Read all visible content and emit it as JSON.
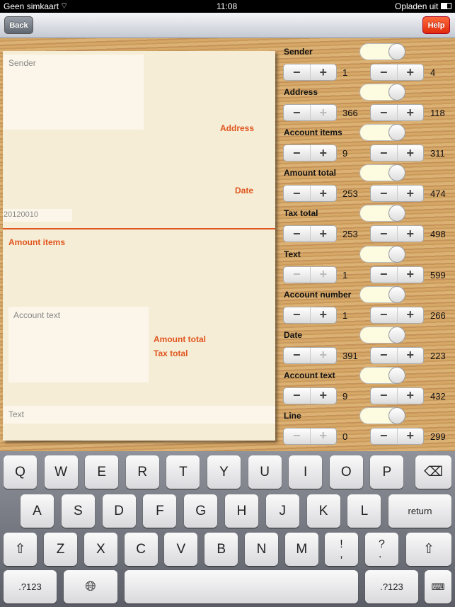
{
  "status": {
    "carrier": "Geen simkaart",
    "time": "11:08",
    "battery": "Opladen uit"
  },
  "nav": {
    "back": "Back",
    "help": "Help"
  },
  "document": {
    "sender_placeholder": "Sender",
    "address": "Address",
    "date": "Date",
    "date_value": "20120010",
    "amount_items": "Amount items",
    "account_text_placeholder": "Account text",
    "amount_total": "Amount total",
    "tax_total": "Tax total",
    "text_placeholder": "Text"
  },
  "controls": [
    {
      "label": "Sender",
      "on": true,
      "v1": "1",
      "v2": "4",
      "dis1": [
        false,
        false
      ]
    },
    {
      "label": "Address",
      "on": true,
      "v1": "366",
      "v2": "118",
      "dis1": [
        false,
        true
      ]
    },
    {
      "label": "Account items",
      "on": true,
      "v1": "9",
      "v2": "311",
      "dis1": [
        false,
        false
      ]
    },
    {
      "label": "Amount total",
      "on": true,
      "v1": "253",
      "v2": "474",
      "dis1": [
        false,
        false
      ]
    },
    {
      "label": "Tax total",
      "on": true,
      "v1": "253",
      "v2": "498",
      "dis1": [
        false,
        false
      ]
    },
    {
      "label": "Text",
      "on": true,
      "v1": "1",
      "v2": "599",
      "dis1": [
        true,
        true
      ]
    },
    {
      "label": "Account number",
      "on": true,
      "v1": "1",
      "v2": "266",
      "dis1": [
        false,
        false
      ]
    },
    {
      "label": "Date",
      "on": true,
      "v1": "391",
      "v2": "223",
      "dis1": [
        false,
        true
      ]
    },
    {
      "label": "Account text",
      "on": true,
      "v1": "9",
      "v2": "432",
      "dis1": [
        false,
        false
      ]
    },
    {
      "label": "Line",
      "on": true,
      "v1": "0",
      "v2": "299",
      "dis1": [
        true,
        true
      ]
    }
  ],
  "keyboard": {
    "row1": [
      "Q",
      "W",
      "E",
      "R",
      "T",
      "Y",
      "U",
      "I",
      "O",
      "P"
    ],
    "row2": [
      "A",
      "S",
      "D",
      "F",
      "G",
      "H",
      "J",
      "K",
      "L"
    ],
    "return": "return",
    "row3": [
      "Z",
      "X",
      "C",
      "V",
      "B",
      "N",
      "M"
    ],
    "excl": "!\n,",
    "quest": "?\n.",
    "numbers": ".?123"
  },
  "colors": {
    "accent": "#e0561f",
    "help": "#e8401a"
  }
}
